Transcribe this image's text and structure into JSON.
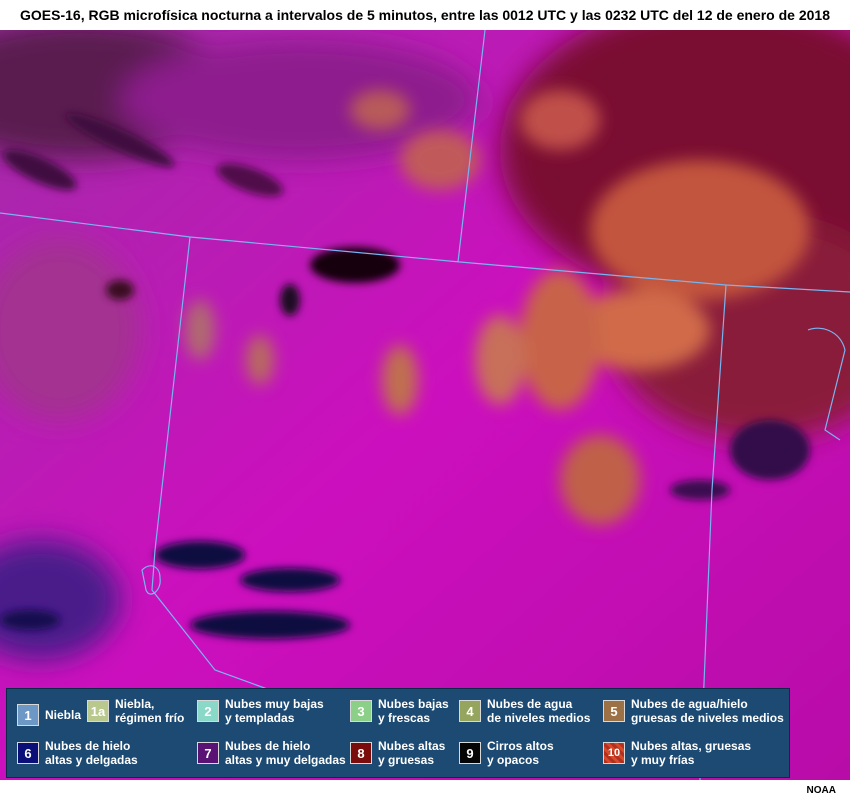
{
  "title": "GOES-16, RGB microfísica nocturna a intervalos de 5 minutos, entre las 0012 UTC y las 0232 UTC del 12 de enero de 2018",
  "credit": "NOAA",
  "legend": [
    {
      "num": "1",
      "label": "Niebla",
      "color": "#6d97c4"
    },
    {
      "num": "1a",
      "label": "Niebla,\nrégimen frío",
      "color": "#b9c98e"
    },
    {
      "num": "2",
      "label": "Nubes muy bajas\ny templadas",
      "color": "#8ad8c8"
    },
    {
      "num": "3",
      "label": "Nubes bajas\ny frescas",
      "color": "#8ccf88"
    },
    {
      "num": "4",
      "label": "Nubes de agua\nde niveles medios",
      "color": "#95a55e"
    },
    {
      "num": "5",
      "label": "Nubes de agua/hielo\ngruesas de niveles medios",
      "color": "#9c7145"
    },
    {
      "num": "6",
      "label": "Nubes de hielo\naltas y delgadas",
      "color": "#0b0f78"
    },
    {
      "num": "7",
      "label": "Nubes de hielo\naltas y muy delgadas",
      "color": "#5a1275"
    },
    {
      "num": "8",
      "label": "Nubes altas\ny gruesas",
      "color": "#7a0c0c"
    },
    {
      "num": "9",
      "label": "Cirros altos\ny opacos",
      "color": "#050505"
    },
    {
      "num": "10",
      "label": "Nubes altas, gruesas\ny muy frías",
      "color": "#b2301f"
    }
  ]
}
